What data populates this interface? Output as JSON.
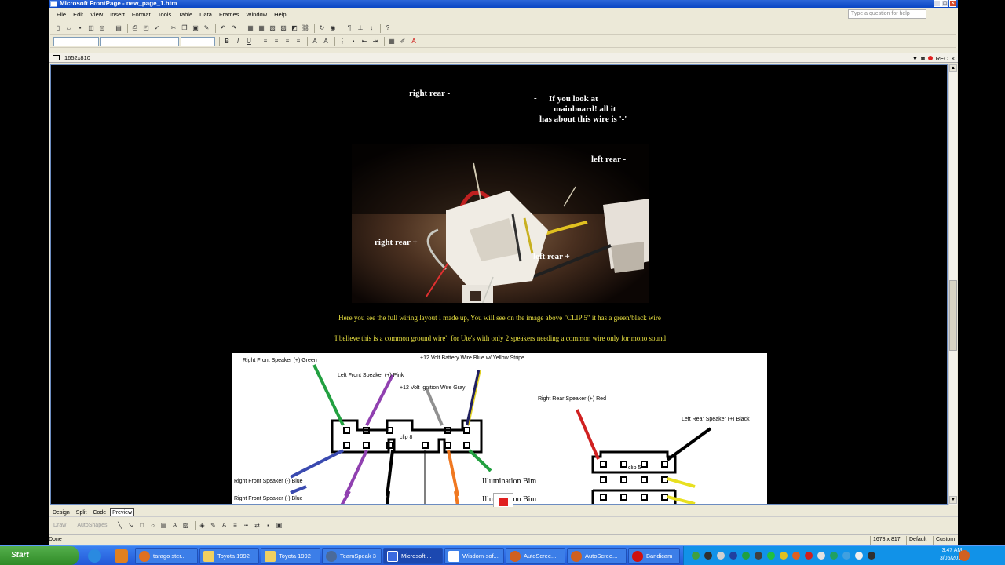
{
  "window": {
    "title": "Microsoft FrontPage - new_page_1.htm",
    "ask_placeholder": "Type a question for help"
  },
  "menu": [
    "File",
    "Edit",
    "View",
    "Insert",
    "Format",
    "Tools",
    "Table",
    "Data",
    "Frames",
    "Window",
    "Help"
  ],
  "docbar": {
    "page_size": "1652x810",
    "rec_label": "REC"
  },
  "photo_labels": {
    "right_rear_minus": "right rear -",
    "dash": "-",
    "mainboard_1": "If you look at",
    "mainboard_2": "mainboard! all it",
    "mainboard_3": "has about this wire is '-'",
    "left_rear_minus": "left rear -",
    "right_rear_plus": "right rear +",
    "left_rear_plus": "left rear +"
  },
  "captions": {
    "line1": "Here you see the full wiring layout I made up, You will see on the image above \"CLIP 5\" it has a green/black wire",
    "line2": "'I believe this is a common ground wire'! for Ute's with only 2 speakers needing a common wire only for mono sound"
  },
  "diagram": {
    "right_front_pos": "Right Front Speaker (+) Green",
    "left_front_pos": "Left Front Speaker (+) Pink",
    "battery": "+12 Volt Battery Wire Blue w/ Yellow Stripe",
    "ignition": "+12 Volt Ignition Wire Gray",
    "clip8": "clip 8",
    "right_rear_pos": "Right Rear Speaker (+) Red",
    "left_rear_pos": "Left Rear Speaker (+) Black",
    "clip5": "clip 5",
    "right_front_neg_1": "Right Front Speaker (-) Blue",
    "right_front_neg_2": "Right Front Speaker (-) Blue",
    "illum_1": "Illumination Bim",
    "illum_2": "Illumination Bim"
  },
  "view_tabs": [
    "Design",
    "Split",
    "Code",
    "Preview"
  ],
  "drawbar": {
    "draw": "Draw",
    "autoshapes": "AutoShapes"
  },
  "status": {
    "left": "Done",
    "size": "1678 x 817",
    "mode": "Default",
    "custom": "Custom"
  },
  "taskbar": {
    "start": "Start",
    "tasks": [
      "tarago ster...",
      "Toyota 1992",
      "Toyota 1992",
      "TeamSpeak 3",
      "Microsoft ...",
      "Wisdom-sof...",
      "AutoScree...",
      "AutoScree...",
      "Bandicam"
    ],
    "time": "3:47 AM",
    "date": "3/05/2012"
  },
  "colors": {
    "caption": "#e8e040",
    "titlebar": "#0a46c4",
    "rec": "#e02020"
  }
}
